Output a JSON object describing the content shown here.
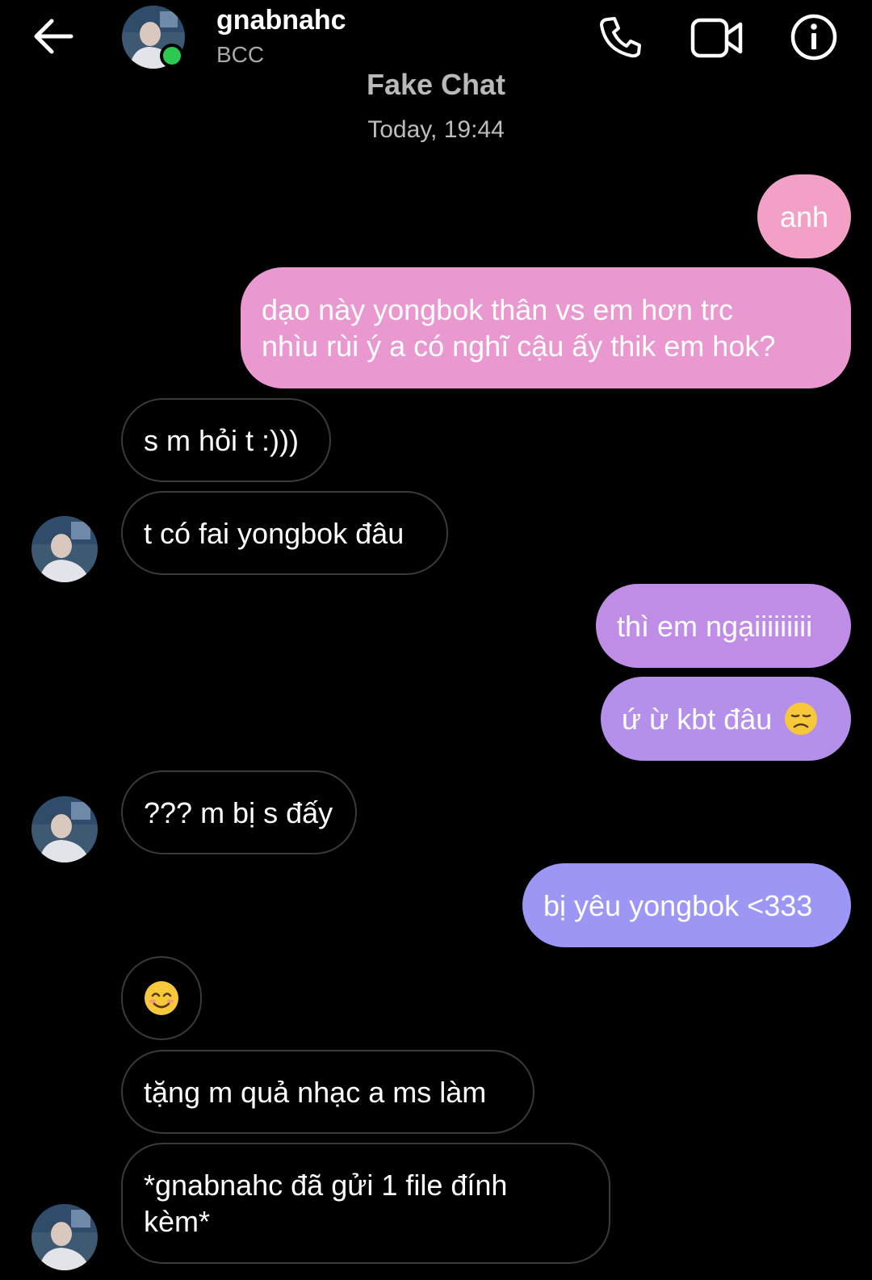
{
  "header": {
    "contact_name": "gnabnahc",
    "contact_subtitle": "BCC",
    "back_icon": "arrow-left-icon",
    "call_icon": "phone-icon",
    "video_icon": "video-camera-icon",
    "info_icon": "info-icon",
    "online_color": "#2bc94f"
  },
  "chat": {
    "title": "Fake Chat",
    "timestamp": "Today, 19:44"
  },
  "messages": [
    {
      "direction": "sent",
      "text": "anh"
    },
    {
      "direction": "sent",
      "text": "dạo này yongbok thân vs em hơn trc\nnhìu rùi ý a có nghĩ cậu ấy thik em hok?"
    },
    {
      "direction": "received",
      "text": "s m hỏi t :)))"
    },
    {
      "direction": "received",
      "text": "t có fai yongbok đâu"
    },
    {
      "direction": "sent",
      "text": "thì em ngạiiiiiiiii"
    },
    {
      "direction": "sent",
      "text": "ứ ừ kbt đâu",
      "emoji": "disappointed-face"
    },
    {
      "direction": "received",
      "text": "??? m bị s đấy"
    },
    {
      "direction": "sent",
      "text": "bị yêu yongbok <333"
    },
    {
      "direction": "received",
      "emoji": "smiling-face-with-smiling-eyes"
    },
    {
      "direction": "received",
      "text": "tặng m quả nhạc a ms làm"
    },
    {
      "direction": "received",
      "text": "*gnabnahc đã gửi 1 file đính\nkèm*"
    }
  ],
  "colors": {
    "background": "#000000",
    "sent_gradient_top": "#f2a0c6",
    "sent_gradient_bottom": "#9c97f5",
    "received_border": "#3a3a3a"
  }
}
